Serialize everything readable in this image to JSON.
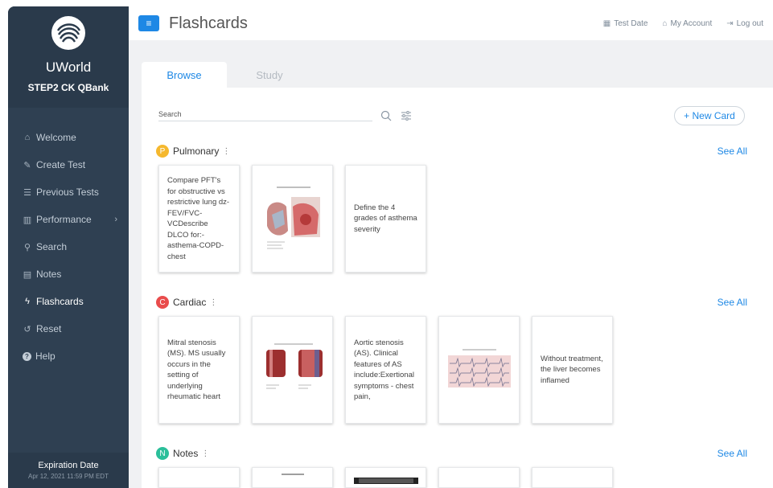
{
  "brand": {
    "name": "UWorld",
    "product": "STEP2 CK QBank"
  },
  "sidebar": {
    "items": [
      {
        "label": "Welcome",
        "icon": "home-icon"
      },
      {
        "label": "Create Test",
        "icon": "edit-icon"
      },
      {
        "label": "Previous Tests",
        "icon": "list-icon"
      },
      {
        "label": "Performance",
        "icon": "chart-icon"
      },
      {
        "label": "Search",
        "icon": "search-icon"
      },
      {
        "label": "Notes",
        "icon": "note-icon"
      },
      {
        "label": "Flashcards",
        "icon": "bolt-icon",
        "active": true
      },
      {
        "label": "Reset",
        "icon": "reset-icon"
      },
      {
        "label": "Help",
        "icon": "help-icon"
      }
    ],
    "expiration": {
      "title": "Expiration Date",
      "value": "Apr 12, 2021 11:59 PM EDT"
    }
  },
  "header": {
    "title": "Flashcards",
    "links": {
      "test_date": "Test Date",
      "account": "My Account",
      "logout": "Log out"
    }
  },
  "tabs": {
    "browse": "Browse",
    "study": "Study"
  },
  "search": {
    "placeholder": "Search"
  },
  "new_card_label": "+ New Card",
  "sections": {
    "pulmonary": {
      "badge": "P",
      "badge_color": "#f5b82e",
      "name": "Pulmonary",
      "see_all": "See All",
      "cards": [
        "Compare PFT's for obstructive vs restrictive lung dz-FEV/FVC-VCDescribe DLCO for:-asthema-COPD-chest",
        "",
        "Define the 4 grades of asthema severity"
      ]
    },
    "cardiac": {
      "badge": "C",
      "badge_color": "#e94c4c",
      "name": "Cardiac",
      "see_all": "See All",
      "cards": [
        "Mitral stenosis (MS).  MS usually occurs in the setting of underlying rheumatic heart",
        "",
        "Aortic stenosis (AS).  Clinical features of AS include:Exertional symptoms - chest pain,",
        "",
        "Without treatment, the liver becomes inflamed"
      ]
    },
    "notes": {
      "badge": "N",
      "badge_color": "#2bbf9a",
      "name": "Notes",
      "see_all": "See All"
    }
  },
  "colors": {
    "accent": "#1e88e5",
    "sidebar": "#2f4052"
  }
}
